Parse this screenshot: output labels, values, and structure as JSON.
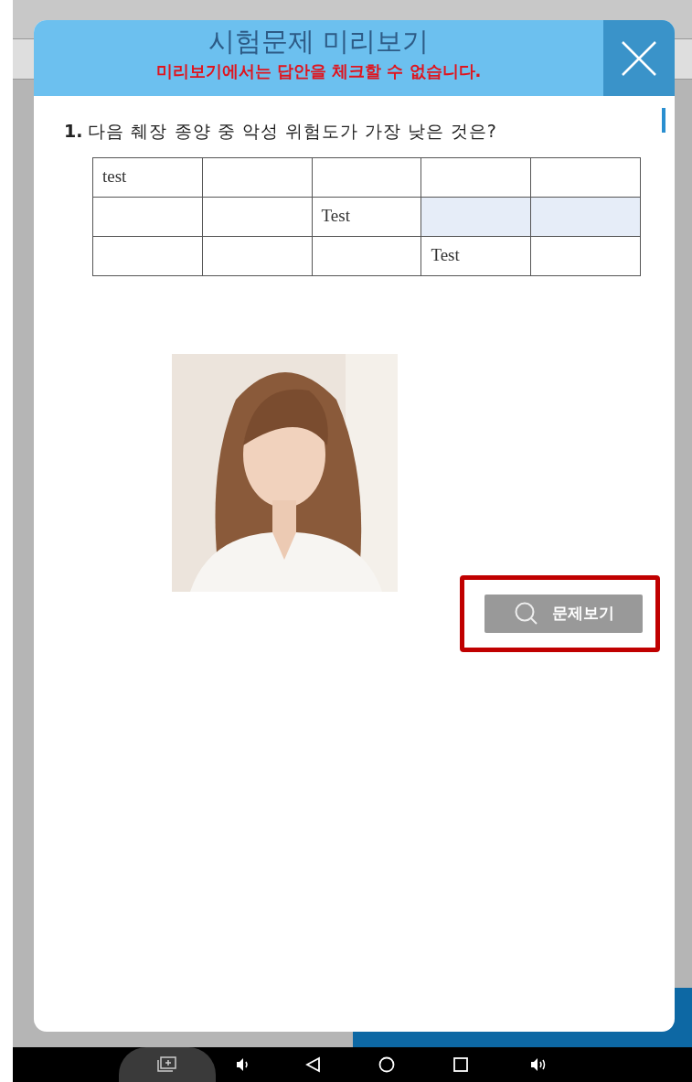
{
  "dialog": {
    "title": "시험문제 미리보기",
    "notice": "미리보기에서는 답안을 체크할 수 없습니다."
  },
  "question": {
    "number": "1.",
    "text": "다음 췌장 종양 중 악성 위험도가 가장 낮은 것은?"
  },
  "table": {
    "rows": [
      {
        "cells": [
          {
            "text": "test",
            "selected": false
          },
          {
            "text": "",
            "selected": false
          },
          {
            "text": "",
            "selected": false
          },
          {
            "text": "",
            "selected": false
          },
          {
            "text": "",
            "selected": false
          }
        ]
      },
      {
        "cells": [
          {
            "text": "",
            "selected": false
          },
          {
            "text": "",
            "selected": false
          },
          {
            "text": "Test",
            "selected": false
          },
          {
            "text": "",
            "selected": true
          },
          {
            "text": "",
            "selected": true
          }
        ]
      },
      {
        "cells": [
          {
            "text": "",
            "selected": false
          },
          {
            "text": "",
            "selected": false
          },
          {
            "text": "",
            "selected": false
          },
          {
            "text": "Test",
            "selected": false
          },
          {
            "text": "",
            "selected": false
          }
        ]
      }
    ]
  },
  "view_button": {
    "label": "문제보기",
    "highlighted": true
  }
}
